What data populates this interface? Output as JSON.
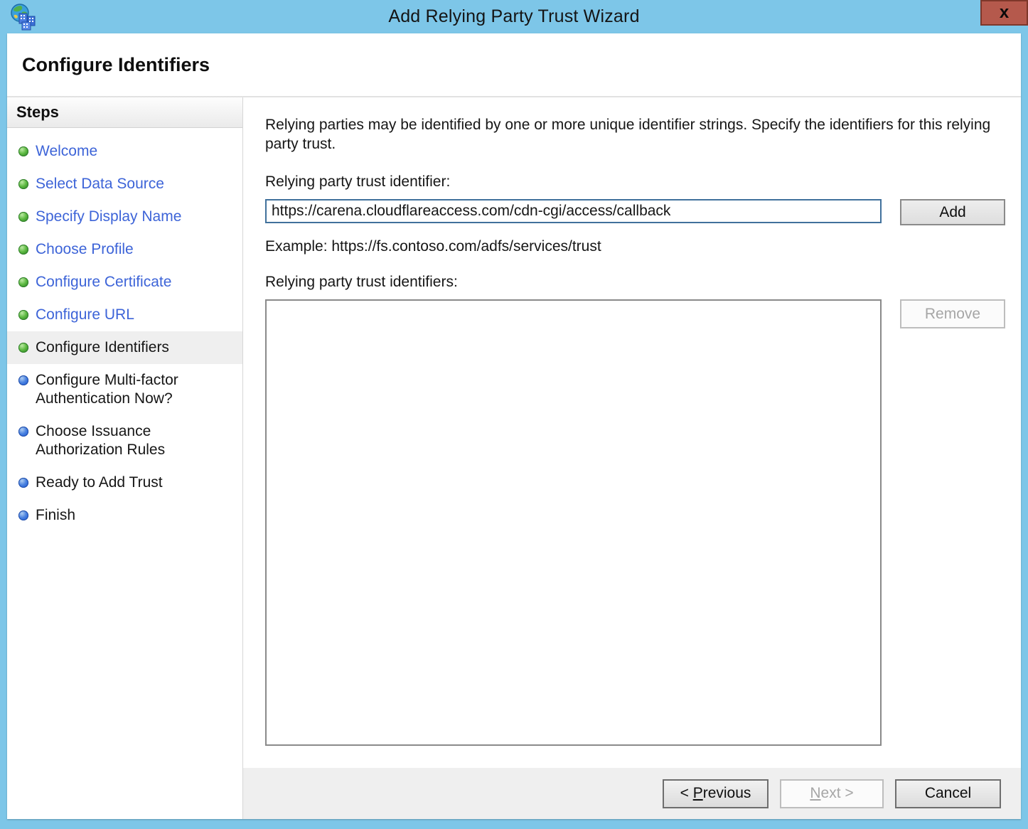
{
  "window": {
    "title": "Add Relying Party Trust Wizard",
    "close_label": "x",
    "app_icon": "adfs-globe-buildings-icon"
  },
  "header": {
    "title": "Configure Identifiers"
  },
  "sidebar": {
    "title": "Steps",
    "steps": [
      {
        "label": "Welcome",
        "bullet": "green",
        "link": true,
        "current": false
      },
      {
        "label": "Select Data Source",
        "bullet": "green",
        "link": true,
        "current": false
      },
      {
        "label": "Specify Display Name",
        "bullet": "green",
        "link": true,
        "current": false
      },
      {
        "label": "Choose Profile",
        "bullet": "green",
        "link": true,
        "current": false
      },
      {
        "label": "Configure Certificate",
        "bullet": "green",
        "link": true,
        "current": false
      },
      {
        "label": "Configure URL",
        "bullet": "green",
        "link": true,
        "current": false
      },
      {
        "label": "Configure Identifiers",
        "bullet": "green",
        "link": false,
        "current": true
      },
      {
        "label": "Configure Multi-factor Authentication Now?",
        "bullet": "blue",
        "link": false,
        "current": false
      },
      {
        "label": "Choose Issuance Authorization Rules",
        "bullet": "blue",
        "link": false,
        "current": false
      },
      {
        "label": "Ready to Add Trust",
        "bullet": "blue",
        "link": false,
        "current": false
      },
      {
        "label": "Finish",
        "bullet": "blue",
        "link": false,
        "current": false
      }
    ]
  },
  "main": {
    "description": "Relying parties may be identified by one or more unique identifier strings. Specify the identifiers for this relying party trust.",
    "identifier_label": "Relying party trust identifier:",
    "identifier_value": "https://carena.cloudflareaccess.com/cdn-cgi/access/callback",
    "add_label": "Add",
    "example": "Example: https://fs.contoso.com/adfs/services/trust",
    "identifiers_label": "Relying party trust identifiers:",
    "identifiers_list": [],
    "remove_label": "Remove"
  },
  "footer": {
    "previous": {
      "text": "< Previous",
      "accel": 2
    },
    "next": {
      "text": "Next >",
      "accel": 0
    },
    "cancel_label": "Cancel"
  },
  "colors": {
    "titlebar_blue": "#7DC6E8",
    "close_bg": "#B5594C",
    "close_border": "#7E372A",
    "link_blue": "#3D64D8",
    "bullet_green": "#46A33C",
    "bullet_blue": "#2E68D8",
    "current_row_bg": "#EFEFEF",
    "input_border": "#41719C",
    "footer_bg": "#EFEFEF",
    "disabled_text": "#A6A6A6"
  }
}
